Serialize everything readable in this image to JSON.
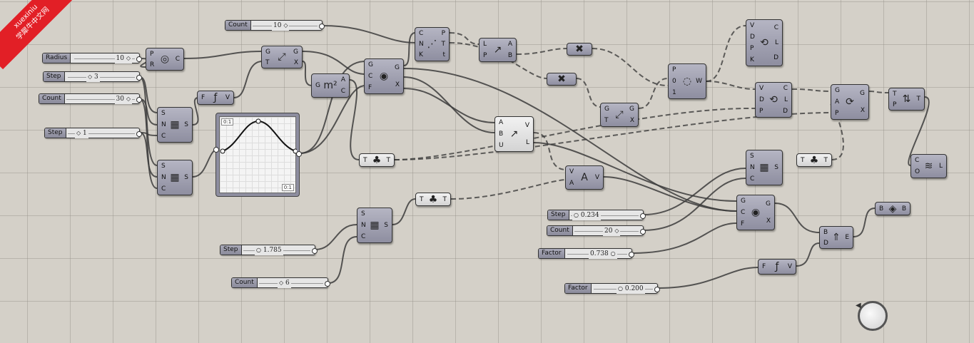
{
  "watermark": {
    "line1": "xuexiniu",
    "line2": "学犀牛中文网",
    "color": "#e21f26"
  },
  "sliders": {
    "radius": {
      "label": "Radius",
      "value": "10"
    },
    "step_a": {
      "label": "Step",
      "value": "3"
    },
    "count_a": {
      "label": "Count",
      "value": "30"
    },
    "step_b": {
      "label": "Step",
      "value": "1"
    },
    "count_top": {
      "label": "Count",
      "value": "10"
    },
    "step_c": {
      "label": "Step",
      "value": "1.785"
    },
    "count_c": {
      "label": "Count",
      "value": "6"
    },
    "step_d": {
      "label": "Step",
      "value": "0.234"
    },
    "count_d": {
      "label": "Count",
      "value": "20"
    },
    "factor_a": {
      "label": "Factor",
      "value": "0.738"
    },
    "factor_b": {
      "label": "Factor",
      "value": "0.200"
    }
  },
  "graph": {
    "tag_tl": "0:1",
    "tag_br": "0:1"
  },
  "components": {
    "circle": {
      "inputs": [
        "P",
        "R"
      ],
      "outputs": [
        "C"
      ],
      "icon": "circle-icon"
    },
    "series_a": {
      "inputs": [
        "S",
        "N",
        "C"
      ],
      "outputs": [
        "S"
      ],
      "icon": "series-icon"
    },
    "series_b": {
      "inputs": [
        "S",
        "N",
        "C"
      ],
      "outputs": [
        "S"
      ],
      "icon": "series-icon"
    },
    "expr_a": {
      "inputs": [
        "F"
      ],
      "outputs": [
        "V"
      ],
      "icon": "expression-icon"
    },
    "move_a": {
      "inputs": [
        "G",
        "T"
      ],
      "outputs": [
        "G",
        "X"
      ],
      "icon": "move-icon"
    },
    "area": {
      "inputs": [
        "G"
      ],
      "outputs": [
        "A",
        "C"
      ],
      "icon": "area-icon"
    },
    "curve_div": {
      "inputs": [
        "C",
        "N",
        "K"
      ],
      "outputs": [
        "P",
        "T",
        "t"
      ],
      "icon": "divide-curve-icon"
    },
    "scale_a": {
      "inputs": [
        "G",
        "C",
        "F"
      ],
      "outputs": [
        "G",
        "X"
      ],
      "icon": "scale-icon"
    },
    "vector2pt": {
      "inputs": [
        "L",
        "P"
      ],
      "outputs": [
        "A",
        "B"
      ],
      "icon": "vector-icon"
    },
    "merge_a": {
      "inputs": [],
      "outputs": [],
      "icon": "merge-icon"
    },
    "merge_b": {
      "inputs": [],
      "outputs": [],
      "icon": "merge-icon"
    },
    "amplitude": {
      "inputs": [
        "A",
        "B",
        "U"
      ],
      "outputs": [
        "V",
        "L"
      ],
      "icon": "amplitude-icon"
    },
    "tree_a": {
      "inputs": [
        "T"
      ],
      "outputs": [
        "T"
      ],
      "icon": "graft-icon"
    },
    "tree_b": {
      "inputs": [
        "T"
      ],
      "outputs": [
        "T"
      ],
      "icon": "graft-icon"
    },
    "series_c": {
      "inputs": [
        "S",
        "N",
        "C"
      ],
      "outputs": [
        "S"
      ],
      "icon": "series-icon"
    },
    "vec_amp": {
      "inputs": [
        "V",
        "A"
      ],
      "outputs": [
        "V"
      ],
      "icon": "vector-amplitude-icon"
    },
    "move_b": {
      "inputs": [
        "G",
        "T"
      ],
      "outputs": [
        "G",
        "X"
      ],
      "icon": "move-icon"
    },
    "polygon": {
      "inputs": [
        "P",
        "0",
        "1"
      ],
      "outputs": [
        "W"
      ],
      "icon": "spiral-icon"
    },
    "interp_a": {
      "inputs": [
        "V",
        "D",
        "P",
        "K"
      ],
      "outputs": [
        "C",
        "L",
        "D"
      ],
      "icon": "interpolate-icon"
    },
    "interp_b": {
      "inputs": [
        "V",
        "D",
        "P"
      ],
      "outputs": [
        "C",
        "L",
        "D"
      ],
      "icon": "interpolate-icon"
    },
    "series_d": {
      "inputs": [
        "S",
        "N",
        "C"
      ],
      "outputs": [
        "S"
      ],
      "icon": "series-icon"
    },
    "tree_c": {
      "inputs": [
        "T"
      ],
      "outputs": [
        "T"
      ],
      "icon": "graft-icon"
    },
    "scale_b": {
      "inputs": [
        "G",
        "C",
        "F"
      ],
      "outputs": [
        "G",
        "X"
      ],
      "icon": "scale-icon"
    },
    "rotate": {
      "inputs": [
        "G",
        "A",
        "P"
      ],
      "outputs": [
        "G",
        "X"
      ],
      "icon": "rotate-icon"
    },
    "flip": {
      "inputs": [
        "T",
        "P"
      ],
      "outputs": [
        "T"
      ],
      "icon": "flip-icon"
    },
    "loft": {
      "inputs": [
        "C",
        "O"
      ],
      "outputs": [
        "L"
      ],
      "icon": "loft-icon"
    },
    "boundary": {
      "inputs": [
        "B",
        "D"
      ],
      "outputs": [
        "E"
      ],
      "icon": "extrude-icon"
    },
    "brep": {
      "inputs": [
        "B"
      ],
      "outputs": [
        "B"
      ],
      "icon": "brep-icon"
    },
    "expr_b": {
      "inputs": [
        "F"
      ],
      "outputs": [
        "V"
      ],
      "icon": "expression-icon"
    }
  }
}
